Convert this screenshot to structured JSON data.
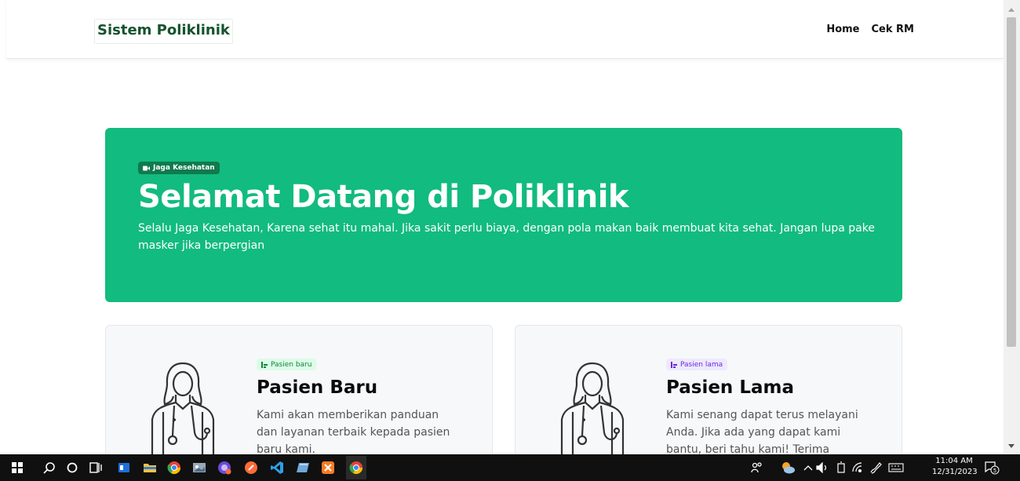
{
  "nav": {
    "brand": "Sistem Poliklinik",
    "links": [
      {
        "label": "Home"
      },
      {
        "label": "Cek RM"
      }
    ]
  },
  "hero": {
    "badge": "Jaga Kesehatan",
    "title": "Selamat Datang di Poliklinik",
    "text": "Selalu Jaga Kesehatan, Karena sehat itu mahal. Jika sakit perlu biaya, dengan pola makan baik membuat kita sehat. Jangan lupa pake masker jika berpergian"
  },
  "cards": [
    {
      "badge": "Pasien baru",
      "title": "Pasien Baru",
      "text": "Kami akan memberikan panduan dan layanan terbaik kepada pasien baru kami."
    },
    {
      "badge": "Pasien lama",
      "title": "Pasien Lama",
      "text": "Kami senang dapat terus melayani Anda. Jika ada yang dapat kami bantu, beri tahu kami! Terima kasih."
    }
  ],
  "taskbar": {
    "time": "11:04 AM",
    "date": "12/31/2023",
    "notification_count": "5"
  },
  "colors": {
    "hero_bg": "#12bb80",
    "brand": "#14532d"
  }
}
